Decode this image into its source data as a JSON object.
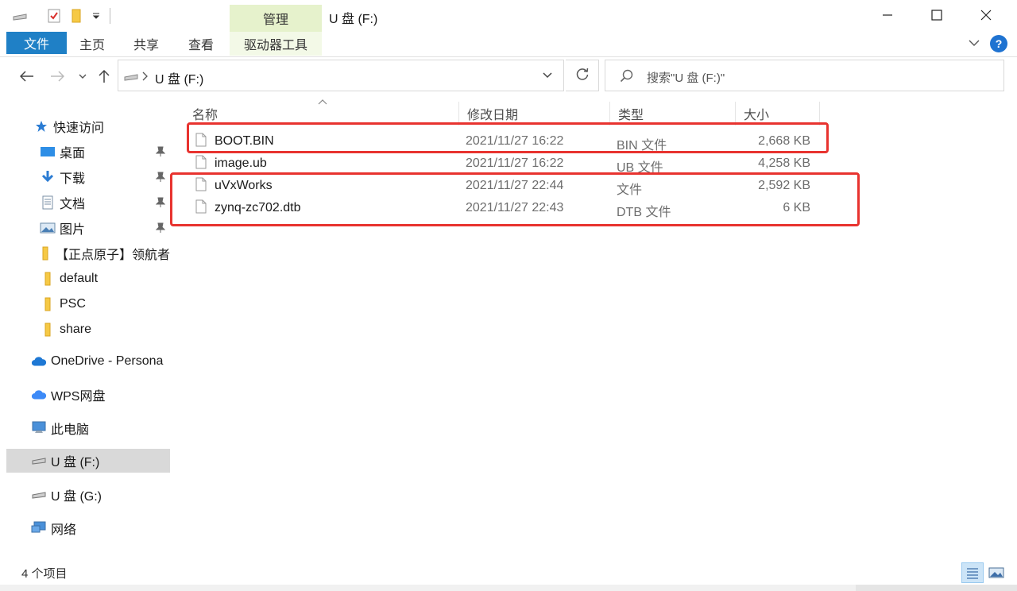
{
  "window": {
    "title": "U 盘 (F:)",
    "manage_tab": "管理",
    "minimize_glyph": "—",
    "maximize_glyph": "☐",
    "close_glyph": "✕"
  },
  "ribbon": {
    "tabs": [
      "文件",
      "主页",
      "共享",
      "查看",
      "驱动器工具"
    ],
    "help_glyph": "?"
  },
  "address": {
    "path": "U 盘 (F:)",
    "search_placeholder": "搜索\"U 盘 (F:)\""
  },
  "nav": {
    "quick_access": "快速访问",
    "items": [
      {
        "label": "桌面",
        "icon": "desktop-icon",
        "pinned": true
      },
      {
        "label": "下载",
        "icon": "download-icon",
        "pinned": true
      },
      {
        "label": "文档",
        "icon": "document-icon",
        "pinned": true
      },
      {
        "label": "图片",
        "icon": "picture-icon",
        "pinned": true
      },
      {
        "label": "【正点原子】领航者",
        "icon": "folder-icon",
        "pinned": false
      },
      {
        "label": "default",
        "icon": "folder-icon",
        "pinned": false
      },
      {
        "label": "PSC",
        "icon": "folder-icon",
        "pinned": false
      },
      {
        "label": "share",
        "icon": "folder-icon",
        "pinned": false
      }
    ],
    "onedrive": "OneDrive - Persona",
    "wps": "WPS网盘",
    "this_pc": "此电脑",
    "drive_f": "U 盘 (F:)",
    "drive_g": "U 盘 (G:)",
    "network": "网络"
  },
  "columns": {
    "name": "名称",
    "date": "修改日期",
    "type": "类型",
    "size": "大小"
  },
  "files": [
    {
      "name": "BOOT.BIN",
      "date": "2021/11/27 16:22",
      "type": "BIN 文件",
      "size": "2,668 KB"
    },
    {
      "name": "image.ub",
      "date": "2021/11/27 16:22",
      "type": "UB 文件",
      "size": "4,258 KB"
    },
    {
      "name": "uVxWorks",
      "date": "2021/11/27 22:44",
      "type": "文件",
      "size": "2,592 KB"
    },
    {
      "name": "zynq-zc702.dtb",
      "date": "2021/11/27 22:43",
      "type": "DTB 文件",
      "size": "6 KB"
    }
  ],
  "status": {
    "item_count": "4 个项目"
  },
  "colors": {
    "file_tab": "#1f80c6",
    "manage_tab": "#e6f2cc",
    "highlight_box": "#e8332f",
    "selected_nav": "#d9d9d9"
  }
}
